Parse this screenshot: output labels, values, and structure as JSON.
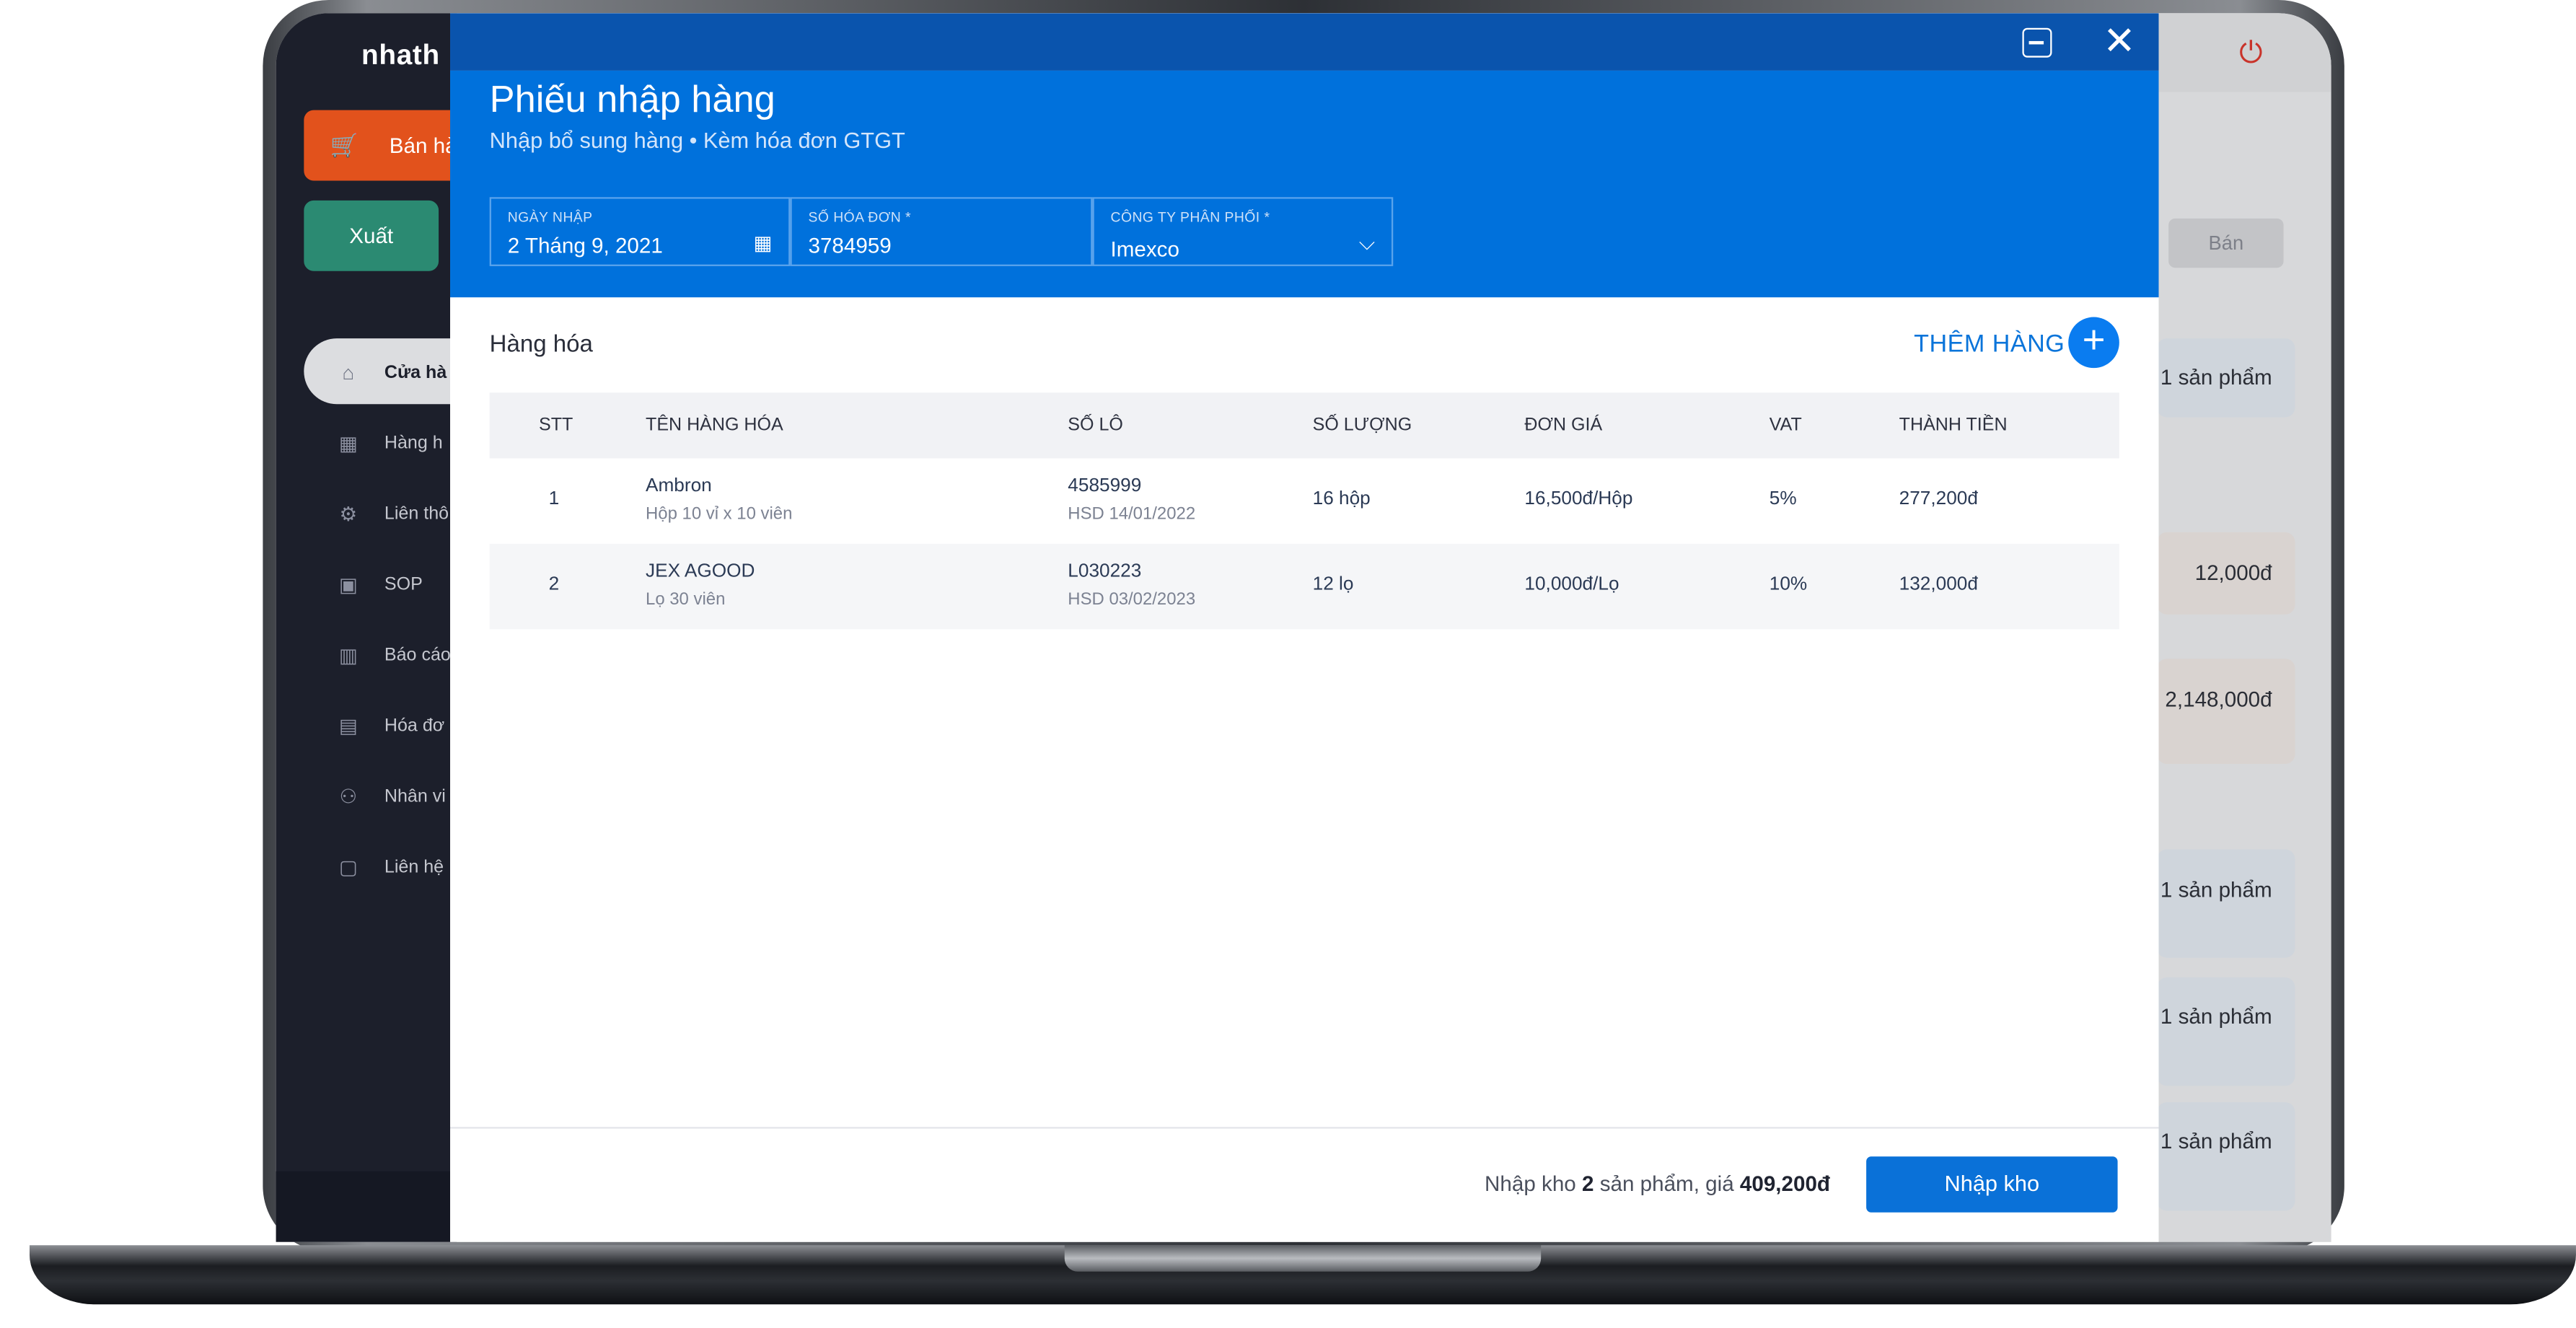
{
  "app": {
    "logo": "nhath"
  },
  "sidebar": {
    "sell_label": "Bán hà",
    "export_label": "Xuất",
    "items": [
      {
        "label": "Cửa hà",
        "icon": "home-icon"
      },
      {
        "label": "Hàng h",
        "icon": "boxes-icon"
      },
      {
        "label": "Liên thô",
        "icon": "link-icon"
      },
      {
        "label": "SOP",
        "icon": "folder-icon"
      },
      {
        "label": "Báo cáo",
        "icon": "chart-icon"
      },
      {
        "label": "Hóa đơ",
        "icon": "document-icon"
      },
      {
        "label": "Nhân vi",
        "icon": "staff-icon"
      },
      {
        "label": "Liên hệ",
        "icon": "contact-icon"
      }
    ],
    "collapse_glyph": "‹"
  },
  "background": {
    "chip_label": "Bán",
    "cards": [
      "1 sản phẩm",
      "12,000đ",
      "2,148,000đ",
      "1 sản phẩm",
      "1 sản phẩm",
      "1 sản phẩm"
    ]
  },
  "modal": {
    "title": "Phiếu nhập hàng",
    "subtitle": "Nhập bổ sung hàng • Kèm hóa đơn GTGT",
    "fields": {
      "date": {
        "label": "NGÀY NHẬP",
        "value": "2 Tháng 9, 2021"
      },
      "invoice": {
        "label": "SỐ HÓA ĐƠN *",
        "value": "3784959"
      },
      "company": {
        "label": "CÔNG TY PHÂN PHỐI *",
        "value": "Imexco"
      }
    },
    "section_title": "Hàng hóa",
    "add_label": "THÊM HÀNG",
    "table": {
      "columns": [
        "STT",
        "TÊN HÀNG HÓA",
        "SỐ LÔ",
        "SỐ LƯỢNG",
        "ĐƠN GIÁ",
        "VAT",
        "THÀNH TIỀN"
      ],
      "rows": [
        {
          "stt": "1",
          "name": "Ambron",
          "pack": "Hộp 10 vỉ x 10 viên",
          "lot": "4585999",
          "exp": "HSD 14/01/2022",
          "qty": "16 hộp",
          "price": "16,500đ/Hộp",
          "vat": "5%",
          "total": "277,200đ"
        },
        {
          "stt": "2",
          "name": "JEX AGOOD",
          "pack": "Lọ 30 viên",
          "lot": "L030223",
          "exp": "HSD 03/02/2023",
          "qty": "12 lọ",
          "price": "10,000đ/Lọ",
          "vat": "10%",
          "total": "132,000đ"
        }
      ]
    },
    "footer": {
      "summary_prefix": "Nhập kho ",
      "summary_count": "2",
      "summary_mid": " sản phẩm, giá ",
      "summary_total": "409,200đ",
      "submit_label": "Nhập kho"
    }
  },
  "colors": {
    "header_blue": "#0071dc",
    "header_dark": "#0a54ad",
    "accent": "#0a7cf0",
    "sell_orange": "#e2521c",
    "export_green": "#2b8a72"
  }
}
